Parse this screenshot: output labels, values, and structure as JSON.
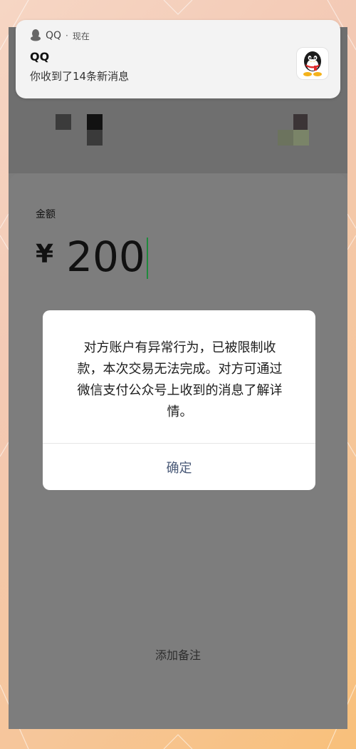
{
  "notification": {
    "app_name": "QQ",
    "time": "现在",
    "title": "QQ",
    "body": "你收到了14条新消息",
    "app_icon": "qq-penguin-icon"
  },
  "payment": {
    "amount_label": "金额",
    "currency_symbol": "¥",
    "amount_value": "200",
    "remark_link": "添加备注"
  },
  "dialog": {
    "message": "对方账户有异常行为，已被限制收款，本次交易无法完成。对方可通过微信支付公众号上收到的消息了解详情。",
    "confirm_label": "确定"
  },
  "colors": {
    "overlay_gray": "#7b7b7b",
    "caret_green": "#1f8a3c",
    "dialog_button_text": "#4a5a78"
  }
}
